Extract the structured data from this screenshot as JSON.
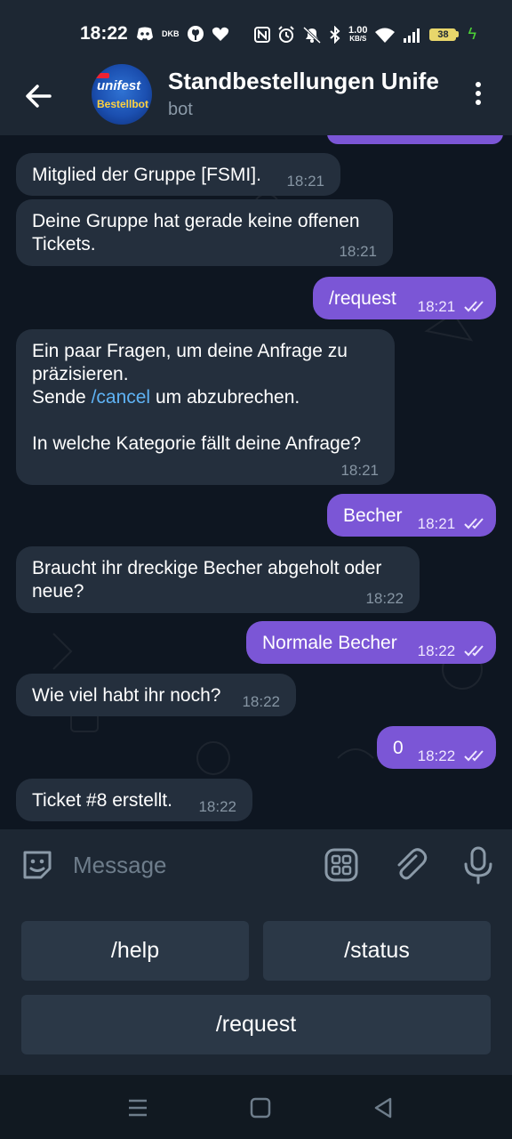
{
  "status_bar": {
    "time": "18:22",
    "left_icons": [
      "discord-icon",
      "dkb-icon",
      "github-icon",
      "heart-icon"
    ],
    "dkb_label": "DKB",
    "right_icons": [
      "nfc-icon",
      "alarm-icon",
      "mute-icon",
      "bluetooth-icon",
      "network-speed-icon",
      "wifi-icon",
      "signal-icon",
      "battery-icon",
      "charging-icon"
    ],
    "net_speed_value": "1.00",
    "net_speed_unit": "KB/S",
    "battery_level": "38"
  },
  "header": {
    "title": "Standbestellungen Unife",
    "subtitle": "bot",
    "avatar_text_top": "unifest",
    "avatar_text_bottom": "Bestellbot"
  },
  "messages": [
    {
      "direction": "in",
      "text": "Mitglied der Gruppe [FSMI].",
      "time": "18:21"
    },
    {
      "direction": "in",
      "text": "Deine Gruppe hat gerade keine offenen Tickets.",
      "time": "18:21"
    },
    {
      "direction": "out",
      "text": "/request",
      "time": "18:21",
      "read": true
    },
    {
      "direction": "in",
      "text_line1": "Ein paar Fragen, um deine Anfrage zu",
      "text_line2": "präzisieren.",
      "text_line3_before": "Sende ",
      "text_line3_link": "/cancel",
      "text_line3_after": " um abzubrechen.",
      "text_line5": "In welche Kategorie fällt deine Anfrage?",
      "time": "18:21"
    },
    {
      "direction": "out",
      "text": "Becher",
      "time": "18:21",
      "read": true
    },
    {
      "direction": "in",
      "text": "Braucht ihr dreckige Becher abgeholt oder neue?",
      "time": "18:22"
    },
    {
      "direction": "out",
      "text": "Normale Becher",
      "time": "18:22",
      "read": true
    },
    {
      "direction": "in",
      "text": "Wie viel habt ihr noch?",
      "time": "18:22"
    },
    {
      "direction": "out",
      "text": "0",
      "time": "18:22",
      "read": true
    },
    {
      "direction": "in",
      "text": "Ticket #8 erstellt.",
      "time": "18:22"
    }
  ],
  "input": {
    "placeholder": "Message"
  },
  "bot_keyboard": {
    "buttons": [
      "/help",
      "/status",
      "/request"
    ]
  },
  "colors": {
    "outgoing_bubble": "#7b56d6",
    "incoming_bubble": "#242f3d",
    "link": "#5fb3f5"
  }
}
